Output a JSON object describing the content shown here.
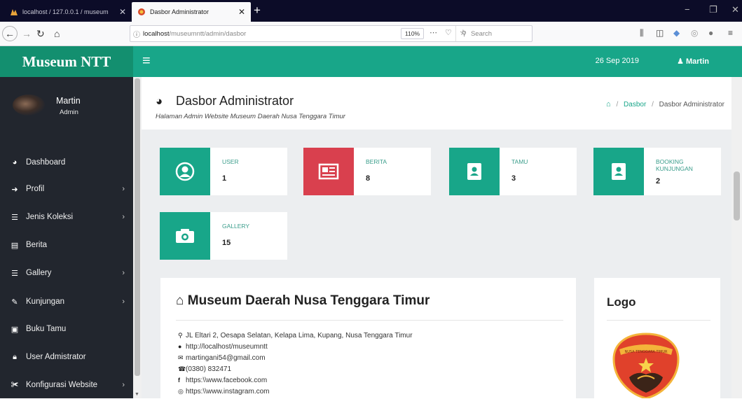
{
  "browser": {
    "tabs": [
      {
        "title": "localhost / 127.0.0.1 / museum",
        "close": "✕"
      },
      {
        "title": "Dasbor Administrator",
        "close": "✕"
      }
    ],
    "new_tab": "+",
    "url_host": "localhost",
    "url_path": "/museumntt/admin/dasbor",
    "zoom": "110%",
    "search_placeholder": "Search",
    "window_controls": [
      "−",
      "❐",
      "✕"
    ]
  },
  "app": {
    "brand": "Museum NTT",
    "date": "26 Sep 2019",
    "top_user": "Martin"
  },
  "sidebar": {
    "user_name": "Martin",
    "user_role": "Admin",
    "items": [
      {
        "label": "Dashboard",
        "icon": "dashboard-icon",
        "has_children": false
      },
      {
        "label": "Profil",
        "icon": "circle-arrow-icon",
        "has_children": true
      },
      {
        "label": "Jenis Koleksi",
        "icon": "list-icon",
        "has_children": true
      },
      {
        "label": "Berita",
        "icon": "newspaper-icon",
        "has_children": false
      },
      {
        "label": "Gallery",
        "icon": "list-icon",
        "has_children": true
      },
      {
        "label": "Kunjungan",
        "icon": "pencil-icon",
        "has_children": true
      },
      {
        "label": "Buku Tamu",
        "icon": "book-icon",
        "has_children": false
      },
      {
        "label": "User Admistrator",
        "icon": "lock-icon",
        "has_children": false
      },
      {
        "label": "Konfigurasi Website",
        "icon": "wrench-icon",
        "has_children": true
      }
    ]
  },
  "page": {
    "title": "Dasbor Administrator",
    "subtitle": "Halaman Admin Website Museum Daerah Nusa Tenggara Timur",
    "breadcrumb": {
      "link": "Dasbor",
      "current": "Dasbor Administrator",
      "sep": "/"
    }
  },
  "stats": [
    {
      "label": "USER",
      "value": "1",
      "icon": "user-icon",
      "color": "#18a689"
    },
    {
      "label": "BERITA",
      "value": "8",
      "icon": "newspaper-icon",
      "color": "#d9404e"
    },
    {
      "label": "TAMU",
      "value": "3",
      "icon": "address-book-icon",
      "color": "#18a689"
    },
    {
      "label": "BOOKING KUNJUNGAN",
      "value": "2",
      "icon": "address-book-icon",
      "color": "#18a689"
    },
    {
      "label": "GALLERY",
      "value": "15",
      "icon": "camera-icon",
      "color": "#18a689"
    }
  ],
  "museum_card": {
    "title": "Museum Daerah Nusa Tenggara Timur",
    "address": "JL Eltari 2, Oesapa Selatan, Kelapa Lima, Kupang, Nusa Tenggara Timur",
    "website": "http://localhost/museumntt",
    "email": "martingani54@gmail.com",
    "phone": "(0380) 832471",
    "facebook": "https:\\\\www.facebook.com",
    "instagram": "https:\\\\www.instagram.com"
  },
  "logo_card": {
    "title": "Logo",
    "seal_text": "NUSA TENGGARA TIMUR"
  }
}
